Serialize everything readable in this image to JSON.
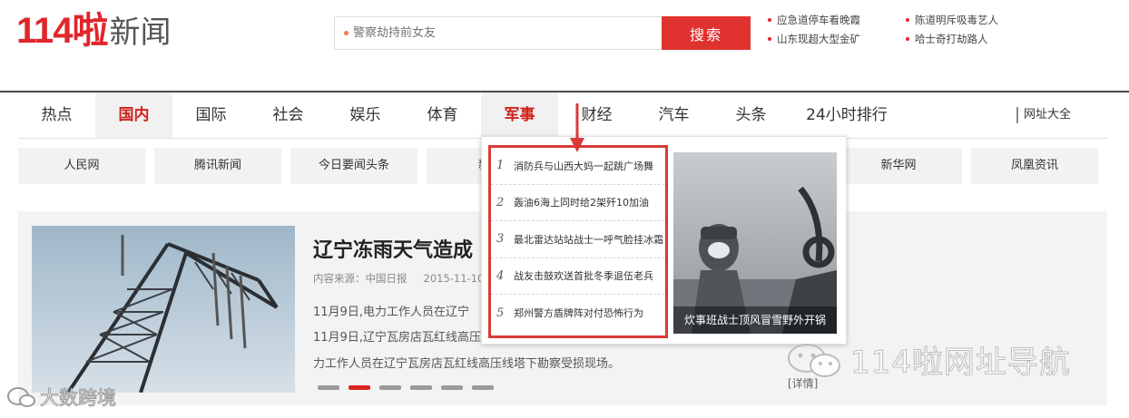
{
  "header": {
    "logo_number": "114啦",
    "logo_text": "新闻",
    "search_placeholder": "警察劫持前女友",
    "search_button": "搜索",
    "hot_links": [
      "应急道停车看晚霞",
      "陈道明斥吸毒艺人",
      "山东现超大型金矿",
      "哈士奇打劫路人"
    ]
  },
  "nav": {
    "items": [
      "热点",
      "国内",
      "国际",
      "社会",
      "娱乐",
      "体育",
      "军事",
      "财经",
      "汽车",
      "头条",
      "24小时排行"
    ],
    "active": "国内",
    "hovered": "军事",
    "sites_link": "网址大全"
  },
  "site_buttons": [
    "人民网",
    "腾讯新闻",
    "今日要闻头条",
    "新浪",
    "新华网",
    "凤凰资讯"
  ],
  "feature": {
    "headline": "辽宁冻雨天气造成",
    "source": "内容来源：中国日报",
    "date": "2015-11-10",
    "lines": [
      "11月9日,电力工作人员在辽宁",
      "11月9日,辽宁瓦房店瓦红线高压",
      "力工作人员在辽宁瓦房店瓦红线高压线塔下勘察受损现场。"
    ],
    "detail_link": "[详情]",
    "slide_count": 6,
    "active_slide": 2
  },
  "dropdown": {
    "items": [
      {
        "num": "1",
        "text": "消防兵与山西大妈一起跳广场舞"
      },
      {
        "num": "2",
        "text": "轰油6海上同时给2架歼10加油"
      },
      {
        "num": "3",
        "text": "最北雷达站站战士一呼气脸挂冰霜"
      },
      {
        "num": "4",
        "text": "战友击鼓欢送首批冬季退伍老兵"
      },
      {
        "num": "5",
        "text": "郑州警方盾牌阵对付恐怖行为"
      }
    ],
    "image_caption": "炊事班战士顶风冒雪野外开锅"
  },
  "watermarks": {
    "right": "114啦网址导航",
    "left": "大数跨境"
  },
  "colors": {
    "brand_red": "#e0262c",
    "search_button": "#e0322e",
    "highlight_box": "#d93a37"
  }
}
